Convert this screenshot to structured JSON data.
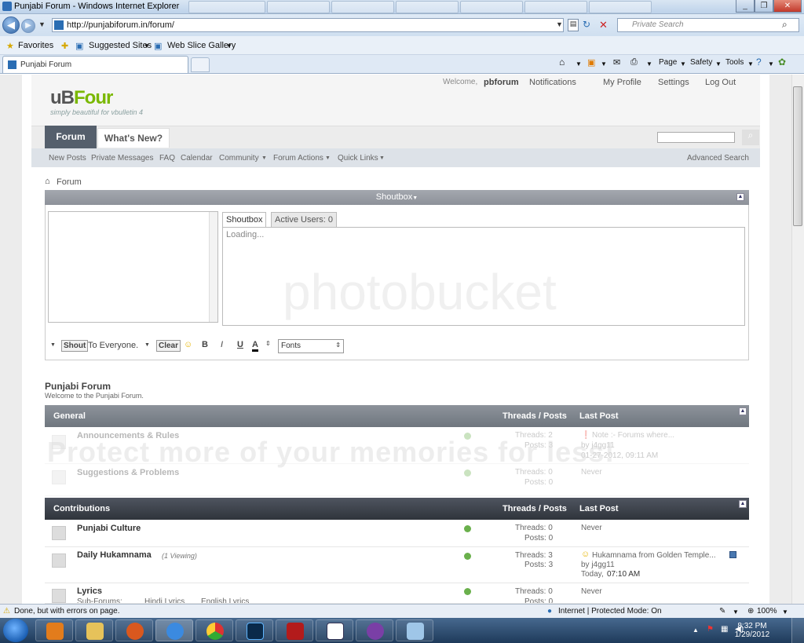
{
  "browser": {
    "title": "Punjabi Forum - Windows Internet Explorer",
    "url": "http://punjabiforum.in/forum/",
    "search_placeholder": "Private Search",
    "favorites": "Favorites",
    "suggested_sites": "Suggested Sites",
    "web_slice_gallery": "Web Slice Gallery",
    "tab_label": "Punjabi Forum",
    "cmd_page": "Page",
    "cmd_safety": "Safety",
    "cmd_tools": "Tools",
    "status_text": "Done, but with errors on page.",
    "zone_text": "Internet | Protected Mode: On",
    "zoom": "100%"
  },
  "site": {
    "logo_main": "uB",
    "logo_accent": "Four",
    "tagline": "simply beautiful for vbulletin 4",
    "welcome": "Welcome,",
    "username": "pbforum",
    "notifications": "Notifications",
    "my_profile": "My Profile",
    "settings": "Settings",
    "logout": "Log Out",
    "tabs": [
      "Forum",
      "What's New?"
    ],
    "subnav": [
      "New Posts",
      "Private Messages",
      "FAQ",
      "Calendar",
      "Community",
      "Forum Actions",
      "Quick Links"
    ],
    "advanced_search": "Advanced Search",
    "breadcrumb": "Forum"
  },
  "shoutbox": {
    "title": "Shoutbox",
    "tab_shoutbox": "Shoutbox",
    "tab_active": "Active Users: 0",
    "loading": "Loading...",
    "shout_btn": "Shout",
    "to_everyone": "To Everyone.",
    "clear_btn": "Clear",
    "fonts": "Fonts",
    "bold": "B",
    "italic": "I",
    "underline": "U",
    "color": "A"
  },
  "forum": {
    "title": "Punjabi Forum",
    "description": "Welcome to the Punjabi Forum.",
    "col_threads_posts": "Threads / Posts",
    "col_last_post": "Last Post",
    "categories": [
      {
        "name": "General",
        "forums": [
          {
            "name": "Announcements & Rules",
            "threads": "Threads: 2",
            "posts": "Posts: 3",
            "last_title": "Note :- Forums where...",
            "last_by": "by j4gg11",
            "last_date": "01-27-2012, 09:11 AM"
          },
          {
            "name": "Suggestions & Problems",
            "threads": "Threads: 0",
            "posts": "Posts: 0",
            "last_title": "Never"
          }
        ]
      },
      {
        "name": "Contributions",
        "forums": [
          {
            "name": "Punjabi Culture",
            "threads": "Threads: 0",
            "posts": "Posts: 0",
            "last_title": "Never"
          },
          {
            "name": "Daily Hukamnama",
            "viewing": "(1 Viewing)",
            "threads": "Threads: 3",
            "posts": "Posts: 3",
            "last_title": "Hukamnama from Golden Temple...",
            "last_by": "by j4gg11",
            "last_date": "Today,",
            "last_time": "07:10 AM"
          },
          {
            "name": "Lyrics",
            "sub": "Sub-Forums:",
            "sub1": "Hindi Lyrics",
            "sub2": "English Lyrics",
            "threads": "Threads: 0",
            "posts": "Posts: 0",
            "last_title": "Never"
          }
        ]
      }
    ]
  },
  "watermark": {
    "line1": "photobucket",
    "line2": "Protect more of your memories for less!"
  },
  "taskbar": {
    "time": "8:32 PM",
    "date": "1/29/2012"
  }
}
